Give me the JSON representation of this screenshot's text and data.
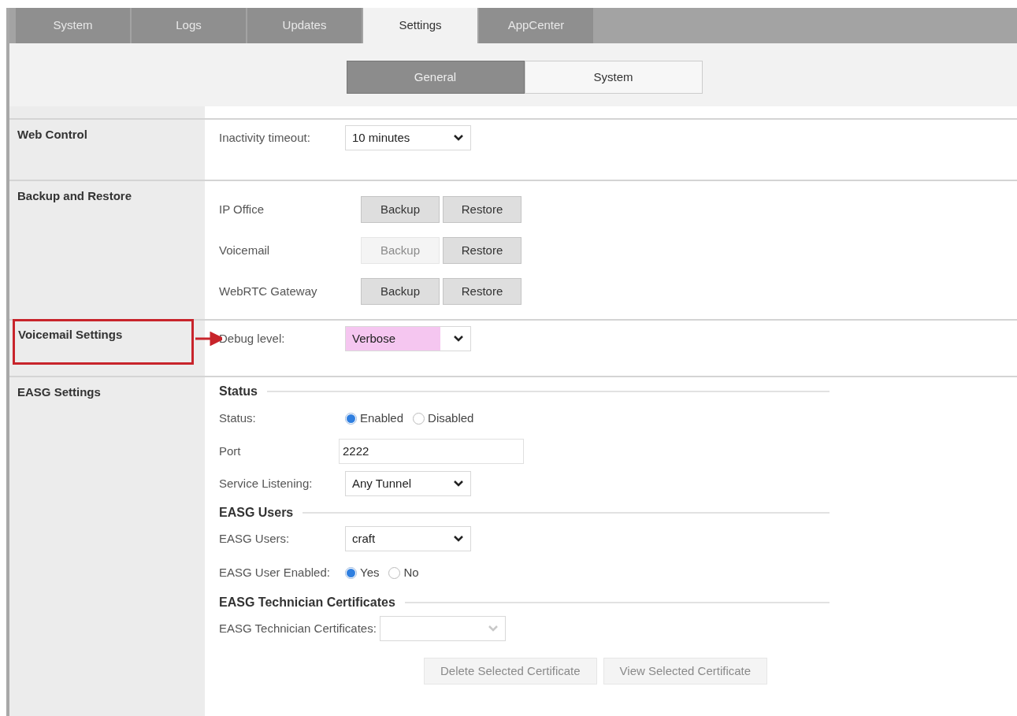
{
  "tabs": [
    {
      "label": "System",
      "selected": false
    },
    {
      "label": "Logs",
      "selected": false
    },
    {
      "label": "Updates",
      "selected": false
    },
    {
      "label": "Settings",
      "selected": true
    },
    {
      "label": "AppCenter",
      "selected": false
    }
  ],
  "subtabs": [
    {
      "label": "General",
      "selected": true
    },
    {
      "label": "System",
      "selected": false
    }
  ],
  "sections": [
    {
      "title": "Web Control",
      "highlighted": false,
      "rows": [
        {
          "kind": "select",
          "label": "Inactivity timeout:",
          "value": "10 minutes",
          "highlighted": false,
          "disabled": false
        }
      ]
    },
    {
      "title": "Backup and Restore",
      "highlighted": false,
      "rows": [
        {
          "kind": "buttons",
          "label": "IP Office",
          "buttons": [
            {
              "label": "Backup",
              "disabled": false
            },
            {
              "label": "Restore",
              "disabled": false
            }
          ]
        },
        {
          "kind": "buttons",
          "label": "Voicemail",
          "buttons": [
            {
              "label": "Backup",
              "disabled": true
            },
            {
              "label": "Restore",
              "disabled": false
            }
          ]
        },
        {
          "kind": "buttons",
          "label": "WebRTC Gateway",
          "buttons": [
            {
              "label": "Backup",
              "disabled": false
            },
            {
              "label": "Restore",
              "disabled": false
            }
          ]
        }
      ]
    },
    {
      "title": "Voicemail Settings",
      "highlighted": true,
      "rows": [
        {
          "kind": "select",
          "label": "Debug level:",
          "value": "Verbose",
          "highlighted": true,
          "disabled": false
        }
      ]
    },
    {
      "title": "EASG Settings",
      "highlighted": false,
      "rows": [
        {
          "kind": "heading",
          "label": "Status"
        },
        {
          "kind": "radio",
          "label": "Status:",
          "options": [
            {
              "label": "Enabled",
              "selected": true
            },
            {
              "label": "Disabled",
              "selected": false
            }
          ]
        },
        {
          "kind": "text",
          "label": "Port",
          "value": "2222"
        },
        {
          "kind": "select",
          "label": "Service Listening:",
          "value": "Any Tunnel",
          "highlighted": false,
          "disabled": false
        },
        {
          "kind": "heading",
          "label": "EASG Users"
        },
        {
          "kind": "select",
          "label": "EASG Users:",
          "value": "craft",
          "highlighted": false,
          "disabled": false
        },
        {
          "kind": "radio",
          "label": "EASG User Enabled:",
          "options": [
            {
              "label": "Yes",
              "selected": true
            },
            {
              "label": "No",
              "selected": false
            }
          ]
        },
        {
          "kind": "heading",
          "label": "EASG Technician Certificates"
        },
        {
          "kind": "select",
          "label": "EASG Technician Certificates:",
          "disabled": true
        },
        {
          "kind": "actions",
          "buttons": [
            {
              "label": "Delete Selected Certificate",
              "disabled": true
            },
            {
              "label": "View Selected Certificate",
              "disabled": true
            }
          ]
        }
      ]
    }
  ]
}
